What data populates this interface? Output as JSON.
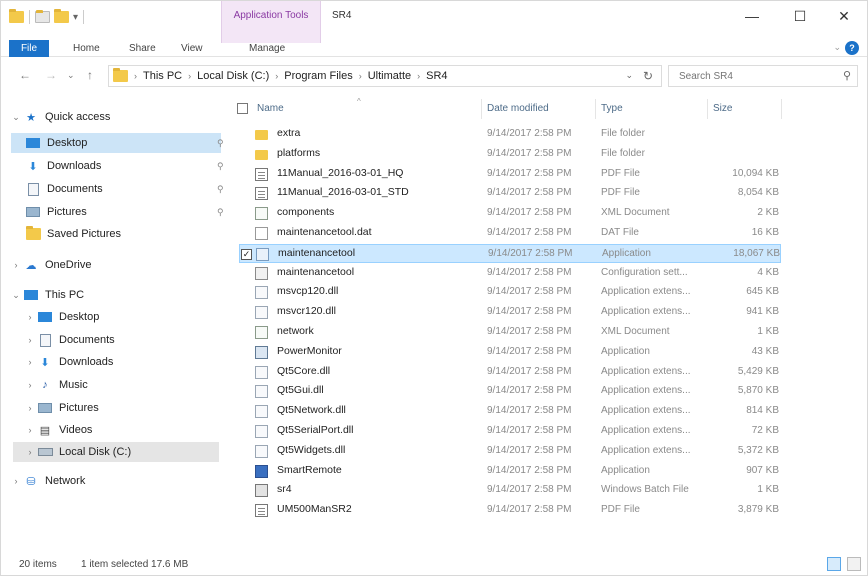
{
  "window": {
    "title": "SR4",
    "context_tab": "Application Tools",
    "context_sub": "Manage",
    "controls": {
      "minimize": "—",
      "maximize": "☐",
      "close": "✕"
    }
  },
  "ribbon": {
    "tabs": [
      "File",
      "Home",
      "Share",
      "View"
    ]
  },
  "address": {
    "crumbs": [
      "This PC",
      "Local Disk (C:)",
      "Program Files",
      "Ultimatte",
      "SR4"
    ],
    "search_placeholder": "Search SR4"
  },
  "nav": {
    "items": [
      {
        "label": "Quick access",
        "chev": "⌄",
        "icon": "★",
        "icon_color": "#1b72c9"
      },
      {
        "label": "Desktop",
        "pin": "📌"
      },
      {
        "label": "Downloads",
        "icon": "⬇",
        "icon_color": "#2b87d9",
        "pin": "📌"
      },
      {
        "label": "Documents",
        "pin": "📌"
      },
      {
        "label": "Pictures",
        "pin": "📌"
      },
      {
        "label": "Saved Pictures"
      },
      {
        "label": "OneDrive",
        "chev": "›",
        "icon": "☁",
        "icon_color": "#2b79d0"
      },
      {
        "label": "This PC",
        "chev": "⌄",
        "icon": "▭",
        "icon_color": "#2b87d9"
      },
      {
        "label": "Desktop",
        "chev": "›"
      },
      {
        "label": "Documents",
        "chev": "›"
      },
      {
        "label": "Downloads",
        "chev": "›",
        "icon": "⬇",
        "icon_color": "#2b87d9"
      },
      {
        "label": "Music",
        "chev": "›",
        "icon": "♪",
        "icon_color": "#2b5fa8"
      },
      {
        "label": "Pictures",
        "chev": "›"
      },
      {
        "label": "Videos",
        "chev": "›",
        "icon": "▤",
        "icon_color": "#444"
      },
      {
        "label": "Local Disk (C:)",
        "chev": "›"
      },
      {
        "label": "Network",
        "chev": "›",
        "icon": "🖧",
        "icon_color": "#2b79d0"
      }
    ]
  },
  "columns": {
    "name": "Name",
    "date": "Date modified",
    "type": "Type",
    "size": "Size"
  },
  "files": [
    {
      "name": "extra",
      "date": "9/14/2017 2:58 PM",
      "type": "File folder",
      "size": "",
      "kind": "folder"
    },
    {
      "name": "platforms",
      "date": "9/14/2017 2:58 PM",
      "type": "File folder",
      "size": "",
      "kind": "folder"
    },
    {
      "name": "11Manual_2016-03-01_HQ",
      "date": "9/14/2017 2:58 PM",
      "type": "PDF File",
      "size": "10,094 KB",
      "kind": "pdf"
    },
    {
      "name": "11Manual_2016-03-01_STD",
      "date": "9/14/2017 2:58 PM",
      "type": "PDF File",
      "size": "8,054 KB",
      "kind": "pdf"
    },
    {
      "name": "components",
      "date": "9/14/2017 2:58 PM",
      "type": "XML Document",
      "size": "2 KB",
      "kind": "xml"
    },
    {
      "name": "maintenancetool.dat",
      "date": "9/14/2017 2:58 PM",
      "type": "DAT File",
      "size": "16 KB",
      "kind": "dat"
    },
    {
      "name": "maintenancetool",
      "date": "9/14/2017 2:58 PM",
      "type": "Application",
      "size": "18,067 KB",
      "kind": "app",
      "selected": true
    },
    {
      "name": "maintenancetool",
      "date": "9/14/2017 2:58 PM",
      "type": "Configuration sett...",
      "size": "4 KB",
      "kind": "cfg"
    },
    {
      "name": "msvcp120.dll",
      "date": "9/14/2017 2:58 PM",
      "type": "Application extens...",
      "size": "645 KB",
      "kind": "dll"
    },
    {
      "name": "msvcr120.dll",
      "date": "9/14/2017 2:58 PM",
      "type": "Application extens...",
      "size": "941 KB",
      "kind": "dll"
    },
    {
      "name": "network",
      "date": "9/14/2017 2:58 PM",
      "type": "XML Document",
      "size": "1 KB",
      "kind": "xml"
    },
    {
      "name": "PowerMonitor",
      "date": "9/14/2017 2:58 PM",
      "type": "Application",
      "size": "43 KB",
      "kind": "pm"
    },
    {
      "name": "Qt5Core.dll",
      "date": "9/14/2017 2:58 PM",
      "type": "Application extens...",
      "size": "5,429 KB",
      "kind": "dll"
    },
    {
      "name": "Qt5Gui.dll",
      "date": "9/14/2017 2:58 PM",
      "type": "Application extens...",
      "size": "5,870 KB",
      "kind": "dll"
    },
    {
      "name": "Qt5Network.dll",
      "date": "9/14/2017 2:58 PM",
      "type": "Application extens...",
      "size": "814 KB",
      "kind": "dll"
    },
    {
      "name": "Qt5SerialPort.dll",
      "date": "9/14/2017 2:58 PM",
      "type": "Application extens...",
      "size": "72 KB",
      "kind": "dll"
    },
    {
      "name": "Qt5Widgets.dll",
      "date": "9/14/2017 2:58 PM",
      "type": "Application extens...",
      "size": "5,372 KB",
      "kind": "dll"
    },
    {
      "name": "SmartRemote",
      "date": "9/14/2017 2:58 PM",
      "type": "Application",
      "size": "907 KB",
      "kind": "sr"
    },
    {
      "name": "sr4",
      "date": "9/14/2017 2:58 PM",
      "type": "Windows Batch File",
      "size": "1 KB",
      "kind": "bat"
    },
    {
      "name": "UM500ManSR2",
      "date": "9/14/2017 2:58 PM",
      "type": "PDF File",
      "size": "3,879 KB",
      "kind": "pdf"
    }
  ],
  "status": {
    "count": "20 items",
    "selection": "1 item selected  17.6 MB"
  },
  "colors": {
    "accent": "#1b72c9",
    "selection": "#cce8ff",
    "context_tab": "#f3e6f6"
  }
}
